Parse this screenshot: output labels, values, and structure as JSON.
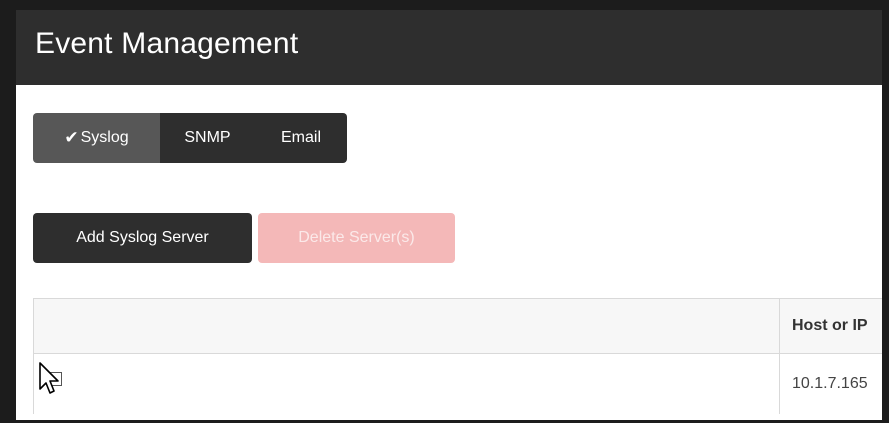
{
  "header": {
    "title": "Event Management"
  },
  "tabs": [
    {
      "label": "Syslog",
      "active": true,
      "check": "✔"
    },
    {
      "label": "SNMP",
      "active": false
    },
    {
      "label": "Email",
      "active": false
    }
  ],
  "actions": {
    "add_label": "Add Syslog Server",
    "delete_label": "Delete Server(s)",
    "delete_disabled": true
  },
  "table": {
    "columns": [
      "",
      "Host or IP"
    ],
    "rows": [
      {
        "checked": false,
        "host": "10.1.7.165"
      }
    ]
  },
  "icons": {
    "check": "checkmark-icon",
    "cursor": "mouse-pointer-icon"
  },
  "colors": {
    "dark": "#2e2e2e",
    "active_tab": "#575757",
    "disabled_delete": "#f4b8b8"
  }
}
